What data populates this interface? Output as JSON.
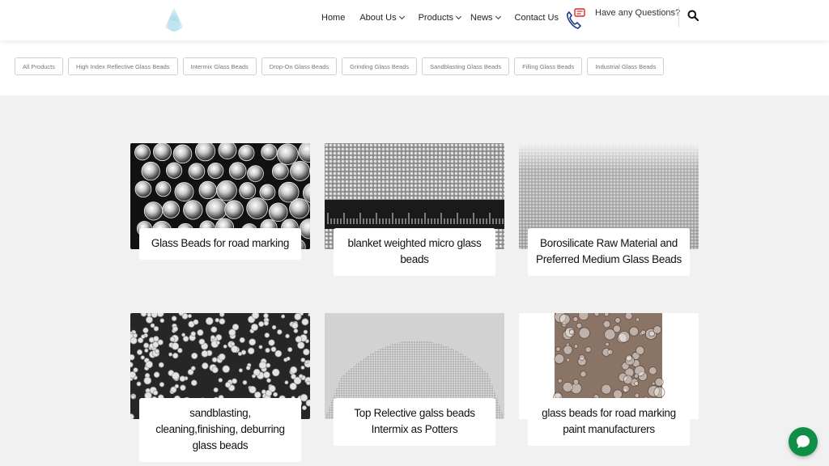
{
  "nav": {
    "items": [
      {
        "label": "Home",
        "dropdown": false
      },
      {
        "label": "About Us",
        "dropdown": true
      },
      {
        "label": "Products",
        "dropdown": true
      },
      {
        "label": "News",
        "dropdown": true
      },
      {
        "label": "Contact Us",
        "dropdown": false
      }
    ]
  },
  "contact": {
    "question": "Have any Questions?"
  },
  "filters": [
    "All Products",
    "High Index Reflective Glass Beads",
    "Intermix Glass Beads",
    "Drop-On Glass Beads",
    "Grinding Glass Beads",
    "Sandblasting Glass Beads",
    "Filling Glass Beads",
    "Industrial Glass Beads"
  ],
  "products": [
    {
      "title": "Glass Beads for road marking"
    },
    {
      "title": "blanket weighted micro glass beads"
    },
    {
      "title": "Borosilicate Raw Material and Preferred Medium Glass Beads"
    },
    {
      "title": "sandblasting, cleaning,finishing, deburring glass beads"
    },
    {
      "title": "Top Relective galss beads Intermix as Potters"
    },
    {
      "title": "glass beads for road marking paint manufacturers"
    }
  ],
  "colors": {
    "accent": "#3b7de0",
    "chat": "#0e8f45",
    "phone_icon": "#1d3a8a",
    "phone_icon_alert": "#d9262b"
  },
  "icons": {
    "logo": "logo-icon",
    "phone": "phone-icon",
    "search": "search-icon",
    "chat": "chat-icon"
  }
}
